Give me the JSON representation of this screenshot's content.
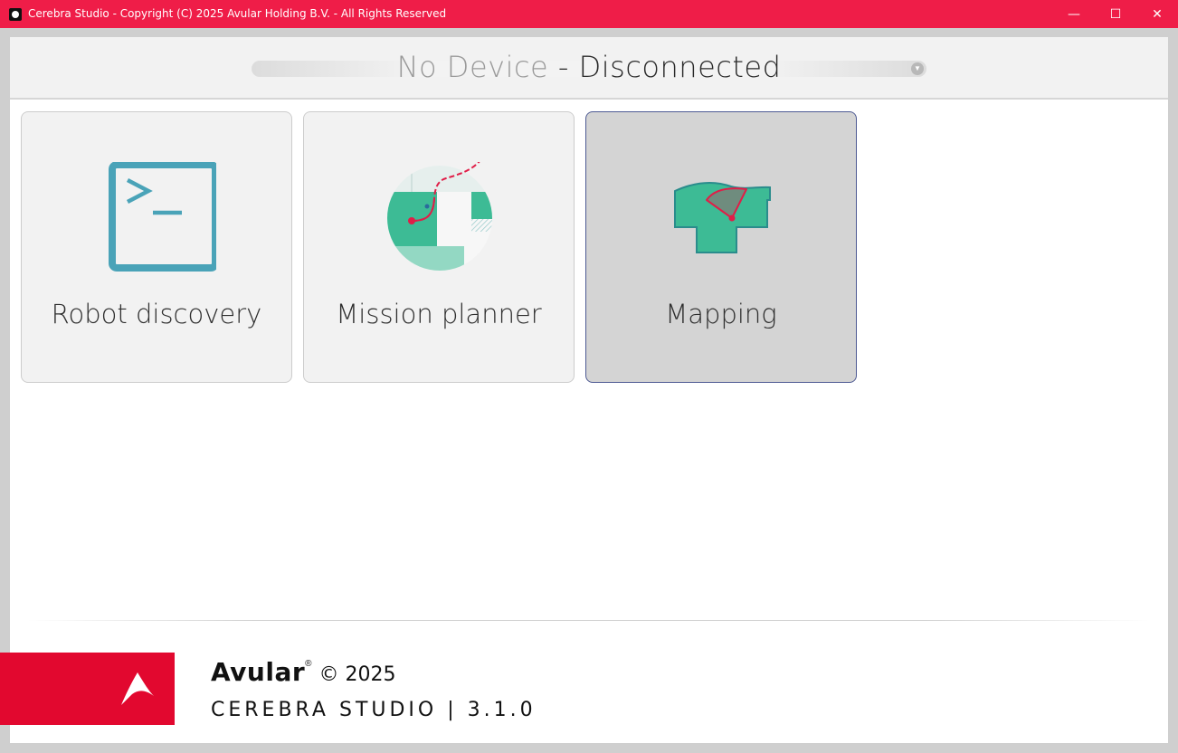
{
  "window": {
    "title": "Cerebra Studio - Copyright (C) 2025 Avular Holding B.V. - All Rights Reserved",
    "controls": {
      "minimize": "—",
      "maximize": "☐",
      "close": "✕"
    },
    "accent": "#ef1d48"
  },
  "header": {
    "device_name": "No Device",
    "separator": " - ",
    "status": "Disconnected",
    "dropdown_caret": "▼"
  },
  "tiles": [
    {
      "label": "Robot discovery",
      "icon": "terminal-icon"
    },
    {
      "label": "Mission planner",
      "icon": "mission-map-icon"
    },
    {
      "label": "Mapping",
      "icon": "mapping-icon",
      "selected": true
    }
  ],
  "footer": {
    "brand": "Avular",
    "registered": "®",
    "copyright": "© 2025",
    "product": "CEREBRA STUDIO | 3.1.0",
    "logo_color": "#e2082f"
  }
}
